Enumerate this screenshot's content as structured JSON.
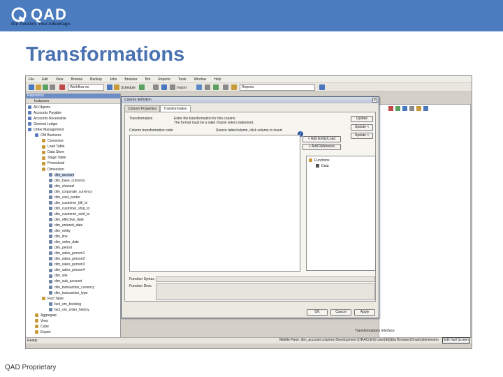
{
  "header": {
    "logo_text": "QAD",
    "tagline": "Our Passion. Your Advantage.",
    "title": "Transformations"
  },
  "footer": {
    "text": "QAD Proprietary"
  },
  "app": {
    "menu": [
      "File",
      "Edit",
      "View",
      "Browse",
      "Backup",
      "Jobs",
      "Browser",
      "Bot",
      "Reports",
      "Tools",
      "Window",
      "Help"
    ],
    "toolbar": {
      "workflow_field": "Workflow on",
      "schedule_label": "Schedule",
      "import_label": "Import",
      "reports_field": "Reports"
    },
    "tree_header": "Repository",
    "tree_tab": "Instances",
    "tree_items": [
      {
        "label": "All Objects",
        "indent": 0,
        "color": "#5a7ac0"
      },
      {
        "label": "Accounts Payable",
        "indent": 0,
        "color": "#5a7ac0"
      },
      {
        "label": "Accounts Receivable",
        "indent": 0,
        "color": "#5a7ac0"
      },
      {
        "label": "General Ledger",
        "indent": 0,
        "color": "#5a7ac0"
      },
      {
        "label": "Order Management",
        "indent": 0,
        "color": "#5a7ac0"
      },
      {
        "label": "OM Business",
        "indent": 1,
        "color": "#5a7ac0"
      },
      {
        "label": "Connector",
        "indent": 2,
        "color": "#c89a3a"
      },
      {
        "label": "Load Table",
        "indent": 2,
        "color": "#c89a3a"
      },
      {
        "label": "Data Store",
        "indent": 2,
        "color": "#c89a3a"
      },
      {
        "label": "Stage Table",
        "indent": 2,
        "color": "#c89a3a"
      },
      {
        "label": "Procedural",
        "indent": 2,
        "color": "#c89a3a"
      },
      {
        "label": "Dimension",
        "indent": 2,
        "color": "#c89a3a"
      },
      {
        "label": "dim_account",
        "indent": 3,
        "color": "#6c84a8",
        "selected": true
      },
      {
        "label": "dim_base_currency",
        "indent": 3,
        "color": "#6c84a8"
      },
      {
        "label": "dim_channel",
        "indent": 3,
        "color": "#6c84a8"
      },
      {
        "label": "dim_corporate_currency",
        "indent": 3,
        "color": "#6c84a8"
      },
      {
        "label": "dim_cost_centre",
        "indent": 3,
        "color": "#6c84a8"
      },
      {
        "label": "dim_customer_bill_to",
        "indent": 3,
        "color": "#6c84a8"
      },
      {
        "label": "dim_customer_ship_to",
        "indent": 3,
        "color": "#6c84a8"
      },
      {
        "label": "dim_customer_sold_to",
        "indent": 3,
        "color": "#6c84a8"
      },
      {
        "label": "dim_effective_date",
        "indent": 3,
        "color": "#6c84a8"
      },
      {
        "label": "dim_entered_date",
        "indent": 3,
        "color": "#6c84a8"
      },
      {
        "label": "dim_entity",
        "indent": 3,
        "color": "#6c84a8"
      },
      {
        "label": "dim_line",
        "indent": 3,
        "color": "#6c84a8"
      },
      {
        "label": "dim_order_date",
        "indent": 3,
        "color": "#6c84a8"
      },
      {
        "label": "dim_period",
        "indent": 3,
        "color": "#6c84a8"
      },
      {
        "label": "dim_sales_person1",
        "indent": 3,
        "color": "#6c84a8"
      },
      {
        "label": "dim_sales_person2",
        "indent": 3,
        "color": "#6c84a8"
      },
      {
        "label": "dim_sales_person3",
        "indent": 3,
        "color": "#6c84a8"
      },
      {
        "label": "dim_sales_person4",
        "indent": 3,
        "color": "#6c84a8"
      },
      {
        "label": "dim_site",
        "indent": 3,
        "color": "#6c84a8"
      },
      {
        "label": "dim_sub_account",
        "indent": 3,
        "color": "#6c84a8"
      },
      {
        "label": "dim_transaction_currency",
        "indent": 3,
        "color": "#6c84a8"
      },
      {
        "label": "dim_transaction_type",
        "indent": 3,
        "color": "#6c84a8"
      },
      {
        "label": "Fact Table",
        "indent": 2,
        "color": "#c89a3a"
      },
      {
        "label": "fact_om_booking",
        "indent": 3,
        "color": "#6c84a8"
      },
      {
        "label": "fact_om_order_history",
        "indent": 3,
        "color": "#6c84a8"
      },
      {
        "label": "Aggregate",
        "indent": 1,
        "color": "#c89a3a"
      },
      {
        "label": "View",
        "indent": 1,
        "color": "#c89a3a"
      },
      {
        "label": "Cube",
        "indent": 1,
        "color": "#c89a3a"
      },
      {
        "label": "Export",
        "indent": 1,
        "color": "#c89a3a"
      }
    ],
    "status_left": "Ready",
    "status_right": "Middle Pane: dim_account columns   Development (ORACLE9)   User(dd)dba   Browser(Oracle)dimension",
    "status_button": "Edit Null Screen",
    "right_tab": "Transformations  Interface",
    "dialog": {
      "title": "Column definition",
      "tabs": [
        "Column Properties",
        "Transformation"
      ],
      "transformation_label": "Transformation",
      "instruction_line1": "Enter the transformation for this column.",
      "instruction_line2": "The format must be a valid Oracle select statement.",
      "column_source_label": "Column transformation code",
      "source_hint": "Source table/column, click column to insert",
      "buttons": {
        "update": "Update",
        "update_prev": "Update <",
        "update_next": "Update >",
        "add_entity": "< Add Entity/Load",
        "add_reference": "< Add Reference",
        "ok": "OK",
        "cancel": "Cancel",
        "apply": "Apply"
      },
      "inner_tree": [
        "Functions",
        "Data"
      ],
      "function_syntax_label": "Function Syntax",
      "function_desc_label": "Function Desc"
    }
  }
}
